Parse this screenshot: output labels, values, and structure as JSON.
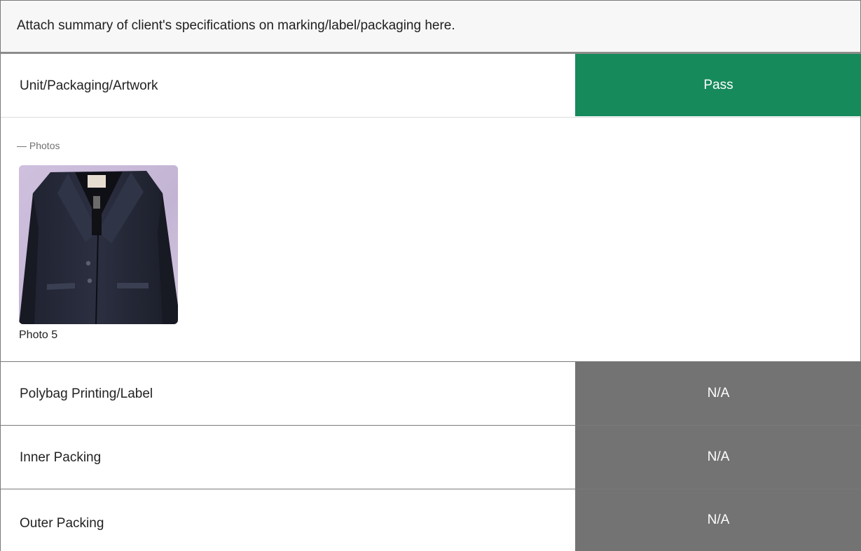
{
  "header": {
    "text": "Attach summary of client's specifications on marking/label/packaging here."
  },
  "checks": [
    {
      "label": "Unit/Packaging/Artwork",
      "result": "Pass",
      "result_color": "#178a5c"
    },
    {
      "label": "Polybag Printing/Label",
      "result": "N/A",
      "result_color": "#737373"
    },
    {
      "label": "Inner Packing",
      "result": "N/A",
      "result_color": "#737373"
    },
    {
      "label": "Outer Packing",
      "result": "N/A",
      "result_color": "#737373"
    }
  ],
  "photos": {
    "toggle_icon": "minus-icon",
    "toggle_label": "Photos",
    "items": [
      {
        "caption": "Photo 5",
        "subject": "dark-blazer-photo"
      }
    ]
  }
}
